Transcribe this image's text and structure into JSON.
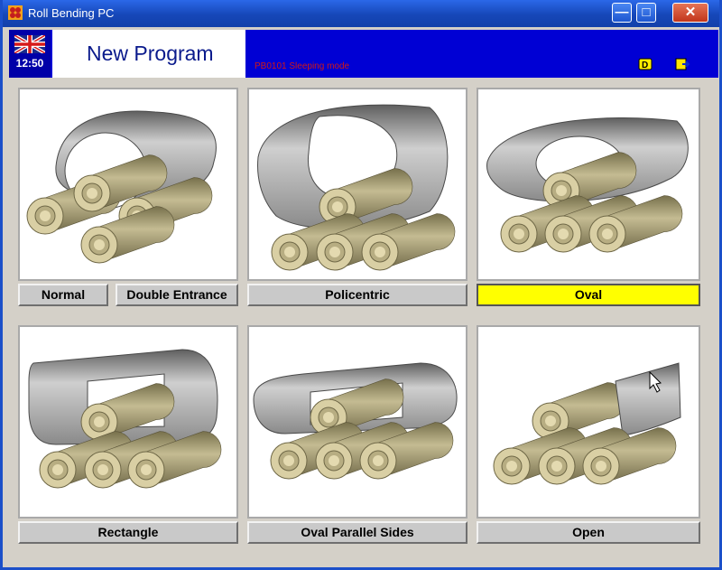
{
  "window": {
    "title": "Roll Bending PC",
    "min_glyph": "—",
    "max_glyph": "□",
    "close_glyph": "✕"
  },
  "header": {
    "clock": "12:50",
    "page_title": "New Program",
    "status": "PB0101 Sleeping mode",
    "icons": [
      "language-flag-icon",
      "d-mode-icon",
      "export-icon"
    ]
  },
  "options": [
    {
      "id": "normal",
      "label": "Normal"
    },
    {
      "id": "double",
      "label": "Double Entrance"
    },
    {
      "id": "policentric",
      "label": "Policentric"
    },
    {
      "id": "oval",
      "label": "Oval",
      "selected": true
    },
    {
      "id": "rectangle",
      "label": "Rectangle"
    },
    {
      "id": "oval-parallel",
      "label": "Oval Parallel Sides"
    },
    {
      "id": "open",
      "label": "Open"
    }
  ],
  "colors": {
    "selected": "#ffff00",
    "header": "#0000d4",
    "titlebar": "#1647b8"
  }
}
